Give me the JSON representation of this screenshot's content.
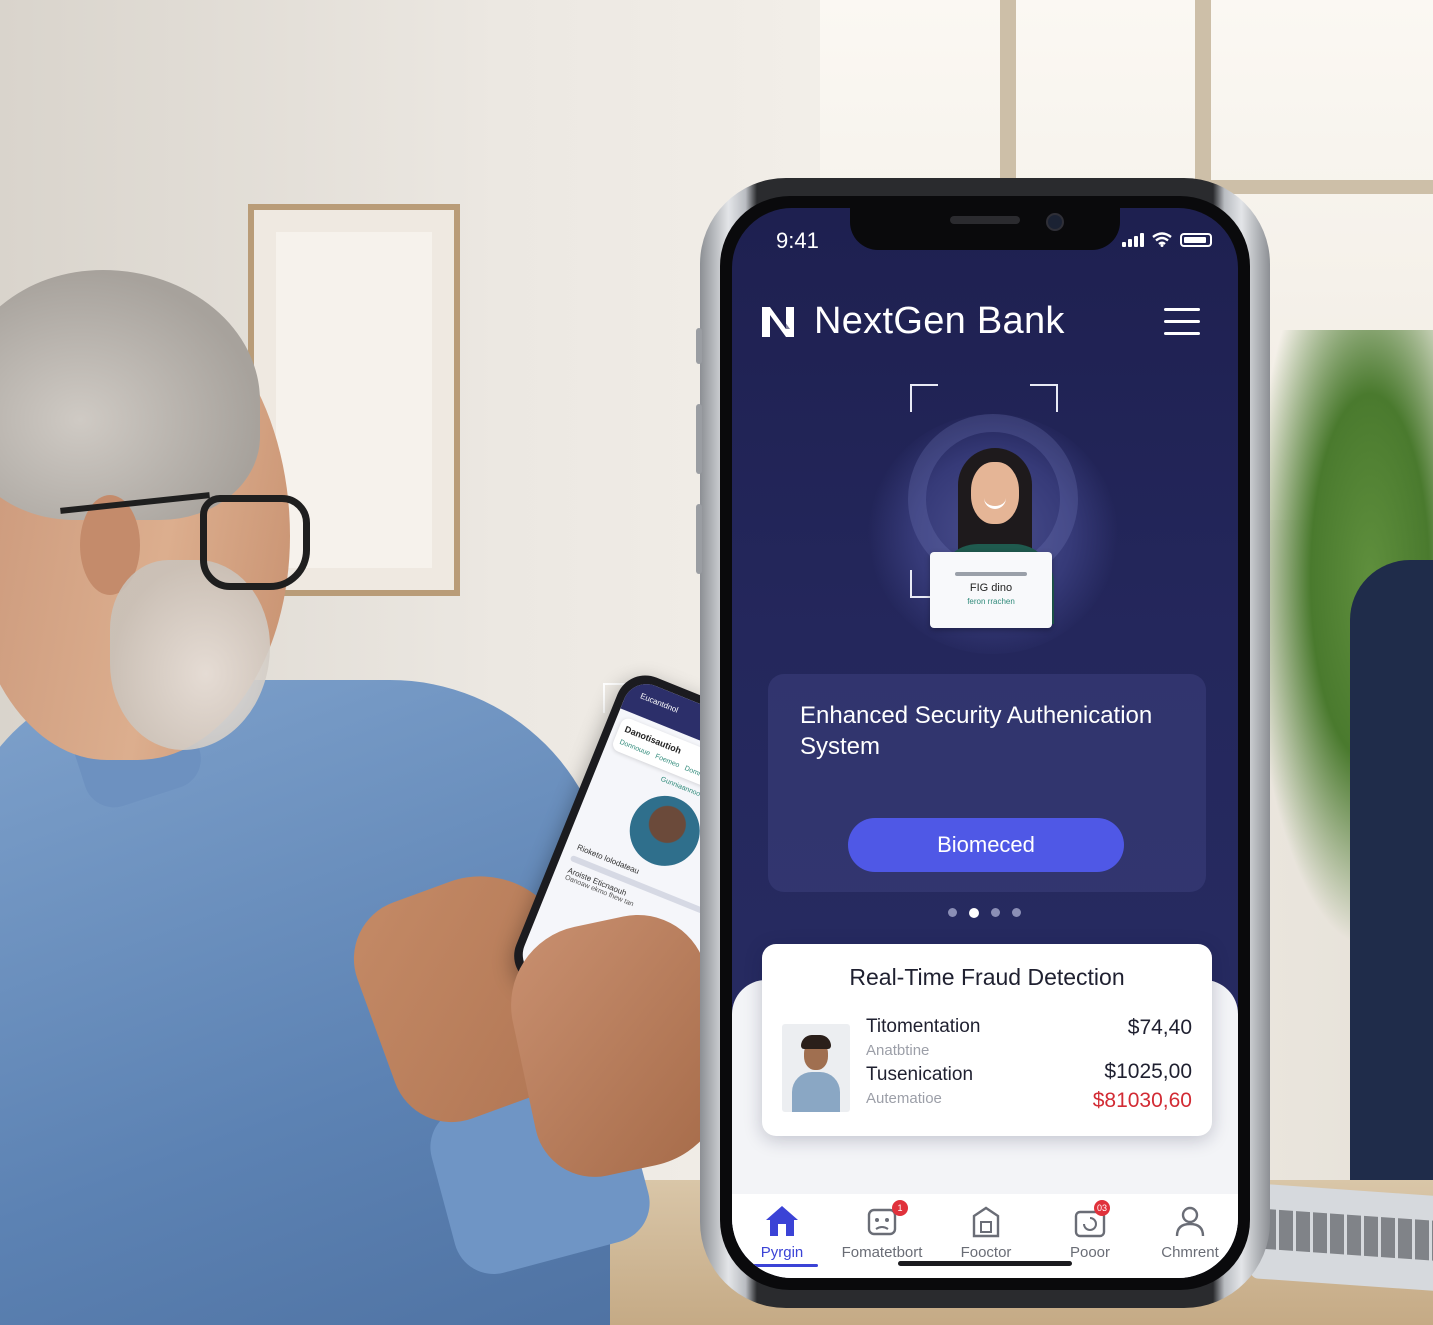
{
  "status_bar": {
    "time": "9:41"
  },
  "app": {
    "brand_name": "NextGen Bank"
  },
  "hero": {
    "id_card_line1": "FIG dino",
    "id_card_line2": "feron rrachen"
  },
  "auth_card": {
    "title": "Enhanced Security Authenication System",
    "button_label": "Biomeced",
    "carousel_pages": 4,
    "carousel_active_index": 1
  },
  "fraud_card": {
    "title": "Real-Time Fraud Detection",
    "transactions": [
      {
        "name": "Titomentation",
        "subtitle": "Anatbtine",
        "amount": "$74,40"
      },
      {
        "name": "Tusenication",
        "subtitle": "Autematioe",
        "amount": "$1025,00"
      }
    ],
    "flagged_amount": "$81030,60"
  },
  "tab_bar": {
    "items": [
      {
        "label": "Pyrgin",
        "icon": "home-icon",
        "active": true
      },
      {
        "label": "Fomatetbort",
        "icon": "robot-face-icon",
        "badge": "1"
      },
      {
        "label": "Fooctor",
        "icon": "lock-bag-icon"
      },
      {
        "label": "Pooor",
        "icon": "refresh-bag-icon",
        "badge": "03"
      },
      {
        "label": "Chmrent",
        "icon": "user-icon"
      }
    ]
  },
  "small_phone": {
    "header": "Eucantdnol",
    "card_title": "Danotisautioh",
    "card_tabs": [
      "Donnouue",
      "Foemeo",
      "Dommoeao"
    ],
    "caption": "Gunniaannood",
    "row1": "Rioketo lolodateau",
    "row2": "Aroiste Eticnaouh",
    "row3": "Oanoaw ekmo fhew tan"
  },
  "colors": {
    "screen_bg": "#24275c",
    "accent_button": "#4f58e6",
    "active_tab": "#3b43d6",
    "flagged_red": "#d22b34",
    "badge_red": "#e0313b"
  }
}
